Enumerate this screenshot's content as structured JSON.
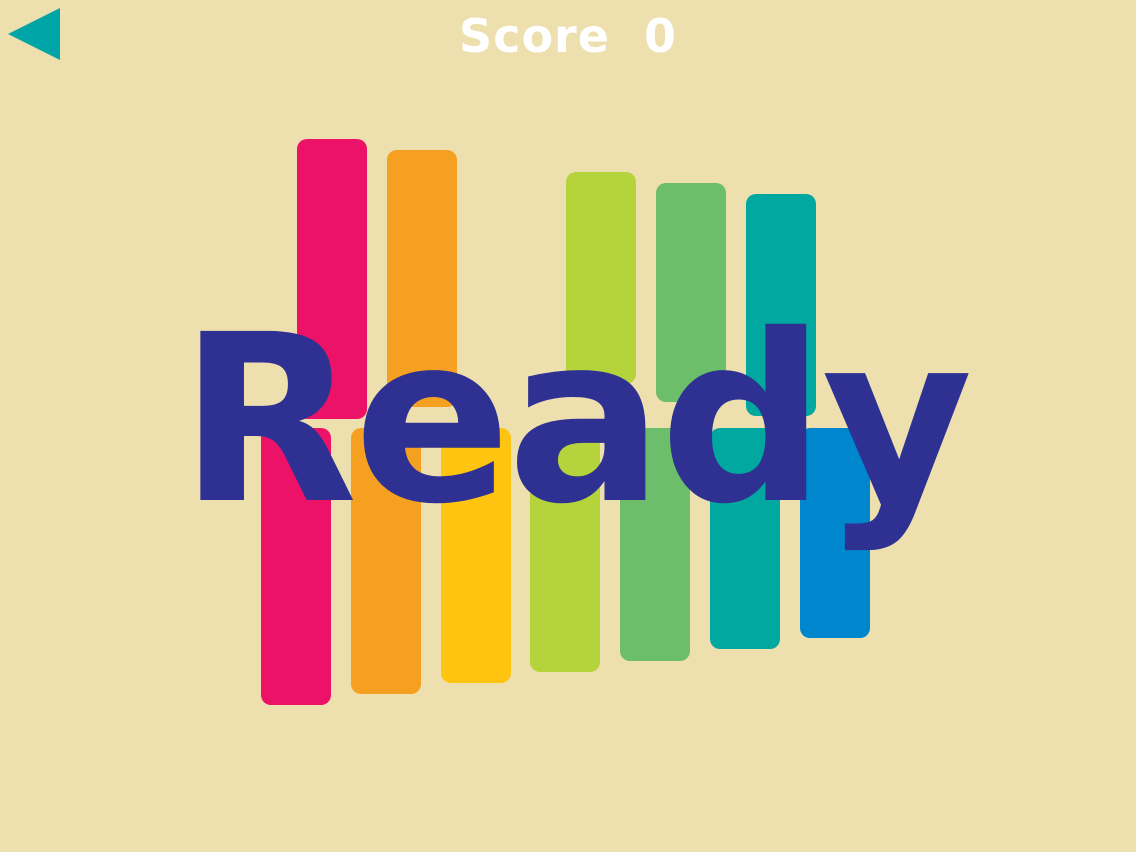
{
  "hud": {
    "score_label": "Score",
    "score_value": "0",
    "back_icon": "back-arrow-icon",
    "back_color": "#00A5A8"
  },
  "overlay": {
    "ready_text": "Ready",
    "ready_color": "#2E3192"
  },
  "keys": {
    "top_row_colors": [
      "#EC1268",
      "#F6A021",
      "#B5D43B",
      "#6DBE6B",
      "#00A89F"
    ],
    "bottom_row_colors": [
      "#EC1268",
      "#F6A021",
      "#FEC410",
      "#B5D43B",
      "#6DBE6B",
      "#00A89F",
      "#0086CD"
    ]
  },
  "colors": {
    "background": "#EDDFAE",
    "score_text": "#FFFFFF"
  }
}
